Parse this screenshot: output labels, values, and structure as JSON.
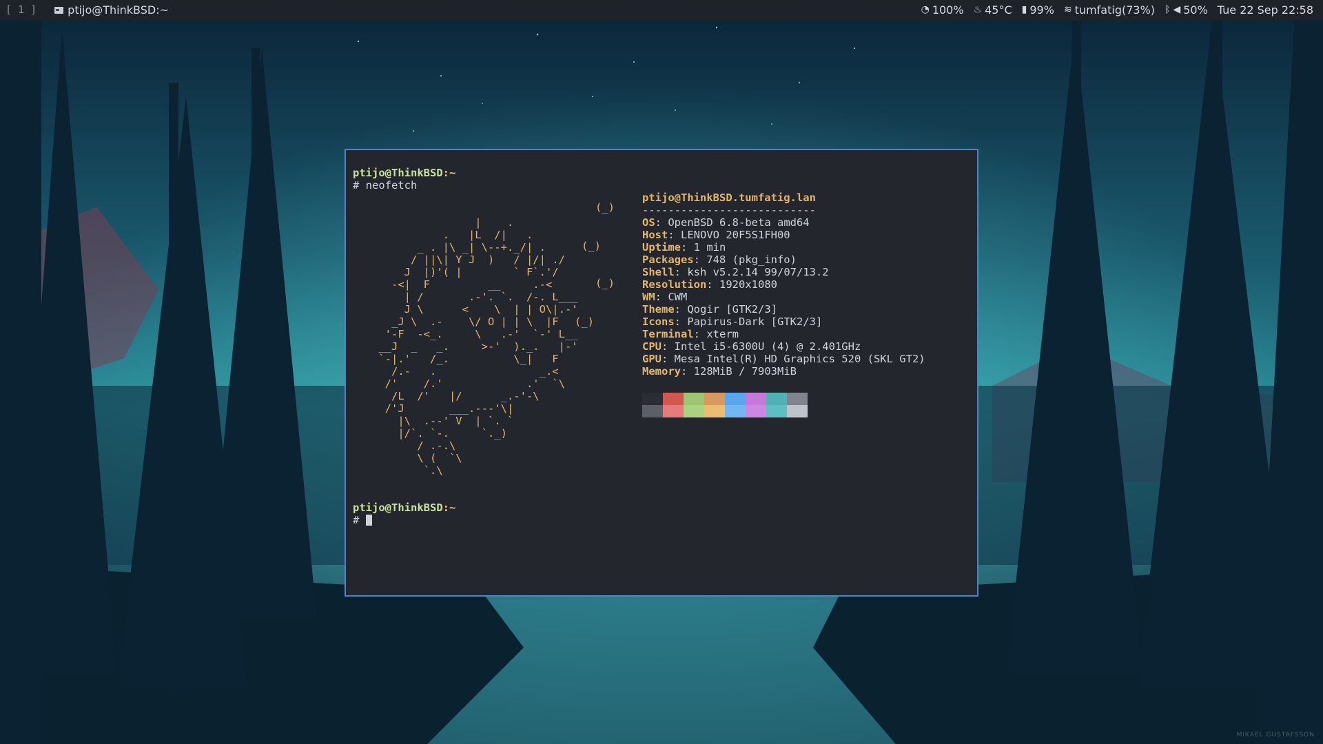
{
  "topbar": {
    "workspace": "[ 1 ]",
    "window_title": "ptijo@ThinkBSD:~",
    "cpu": "100%",
    "temp": "45°C",
    "battery": "99%",
    "wifi": "tumfatig(73%)",
    "volume": "50%",
    "datetime": "Tue 22 Sep 22:58",
    "icons": [
      "window-icon",
      "cpu-gauge-icon",
      "flame-icon",
      "battery-icon",
      "wifi-icon",
      "bluetooth-icon",
      "volume-icon"
    ]
  },
  "terminal": {
    "prompt1": {
      "user_host": "ptijo@ThinkBSD",
      "path": ":~"
    },
    "command1": "# neofetch",
    "logo_lines": [
      "                   |    .",
      "              .   |L  /|   .",
      "          _ . |\\ _| \\--+._/| .",
      "         / ||\\| Y J  )   / |/| ./",
      "        J  |)'( |        ` F`.'/",
      "      -<|  F         __     .-<",
      "        | /       .-'. `.  /-. L___",
      "        J \\      <    \\  | | O\\|.-'",
      "      _J \\  .-    \\/ O | | \\  |F",
      "     '-F  -<_.     \\   .-'  `-' L__",
      "    __J  _   _.     >-'  )._.   |-'",
      "    `-|.'   /_.          \\_|   F",
      "      /.-   .                _.<",
      "     /'    /.'             .'  `\\",
      "      /L  /'   |/      _.-'-\\",
      "     /'J       ___.---'\\|",
      "       |\\  .--' V  | `. `",
      "       |/`. `-.     `._)",
      "          / .-.\\",
      "          \\ (  `\\",
      "           `.\\"
    ],
    "bubbles": [
      "(_)",
      "(_)",
      "(_)",
      "(_)"
    ],
    "info_title": "ptijo@ThinkBSD.tumfatig.lan",
    "info_separator": "---------------------------",
    "info": [
      {
        "key": "OS",
        "value": "OpenBSD 6.8-beta amd64"
      },
      {
        "key": "Host",
        "value": "LENOVO 20F5S1FH00"
      },
      {
        "key": "Uptime",
        "value": "1 min"
      },
      {
        "key": "Packages",
        "value": "748 (pkg_info)"
      },
      {
        "key": "Shell",
        "value": "ksh v5.2.14 99/07/13.2"
      },
      {
        "key": "Resolution",
        "value": "1920x1080"
      },
      {
        "key": "WM",
        "value": "CWM"
      },
      {
        "key": "Theme",
        "value": "Qogir [GTK2/3]"
      },
      {
        "key": "Icons",
        "value": "Papirus-Dark [GTK2/3]"
      },
      {
        "key": "Terminal",
        "value": "xterm"
      },
      {
        "key": "CPU",
        "value": "Intel i5-6300U (4) @ 2.401GHz"
      },
      {
        "key": "GPU",
        "value": "Mesa Intel(R) HD Graphics 520 (SKL GT2)"
      },
      {
        "key": "Memory",
        "value": "128MiB / 7903MiB"
      }
    ],
    "palette_top": [
      "#2b2d34",
      "#d2574f",
      "#9ec571",
      "#d9995e",
      "#59a6ee",
      "#c479db",
      "#4fb0b5",
      "#7f848d"
    ],
    "palette_bottom": [
      "#5b5f67",
      "#e77b7b",
      "#a9d37e",
      "#ebbd6e",
      "#6fb8f4",
      "#cc87e0",
      "#5ebfc3",
      "#bfc3cb"
    ],
    "prompt2": {
      "user_host": "ptijo@ThinkBSD",
      "path": ":~"
    },
    "command2": "# "
  },
  "watermark": "MIKAEL GUSTAFSSON",
  "colors": {
    "bar_bg": "#1e2229",
    "terminal_bg": "#24262e",
    "terminal_border": "#4a86c8",
    "accent_yellow": "#e3b66b",
    "accent_green": "#c9e39b"
  }
}
